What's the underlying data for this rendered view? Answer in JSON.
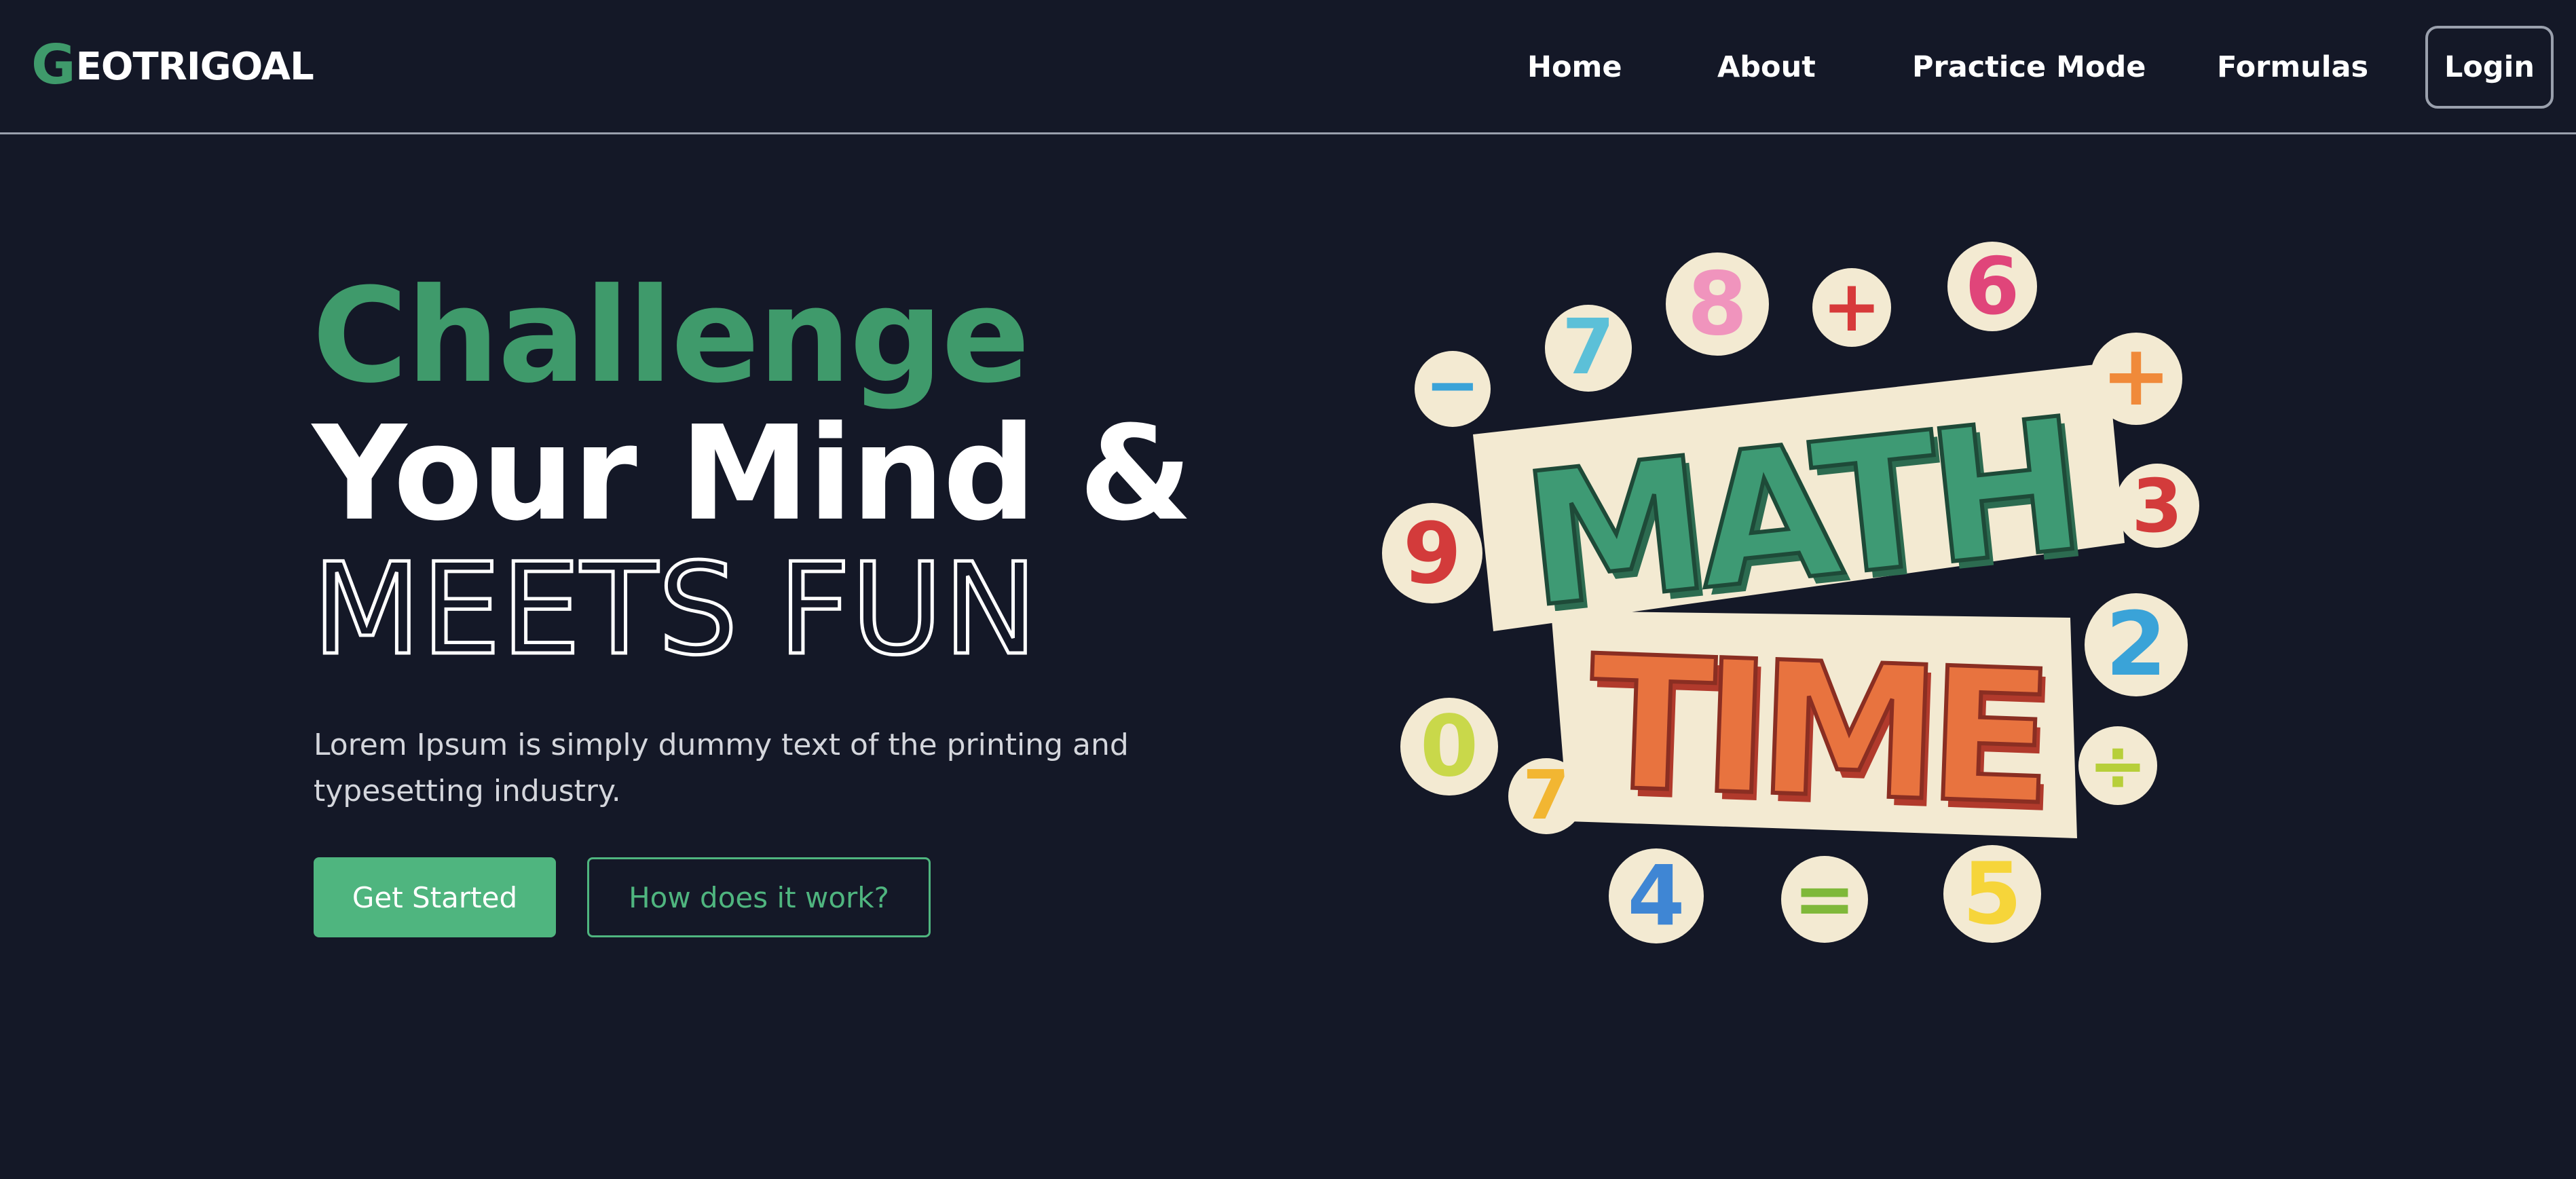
{
  "header": {
    "logo": {
      "first_letter": "G",
      "rest": "EOTRIGOAL"
    },
    "nav": [
      {
        "label": "Home"
      },
      {
        "label": "About"
      },
      {
        "label": "Practice Mode"
      },
      {
        "label": "Formulas"
      }
    ],
    "login_label": "Login"
  },
  "hero": {
    "line1": "Challenge",
    "line2": "Your Mind &",
    "line3": "MEETS FUN",
    "subtitle": "Lorem Ipsum is simply dummy text of the printing and typesetting industry.",
    "primary_button": "Get Started",
    "secondary_button": "How does it work?"
  },
  "illustration": {
    "title_top": "MATH",
    "title_bottom": "TIME",
    "stickers": [
      "−",
      "7",
      "8",
      "+",
      "6",
      "+",
      "9",
      "3",
      "2",
      "0",
      "7",
      "÷",
      "4",
      "=",
      "5"
    ]
  },
  "colors": {
    "background": "#141827",
    "accent_green": "#3f9a6b",
    "button_green": "#4fb57f",
    "math_green": "#3e9a74",
    "time_orange": "#e8733f"
  }
}
